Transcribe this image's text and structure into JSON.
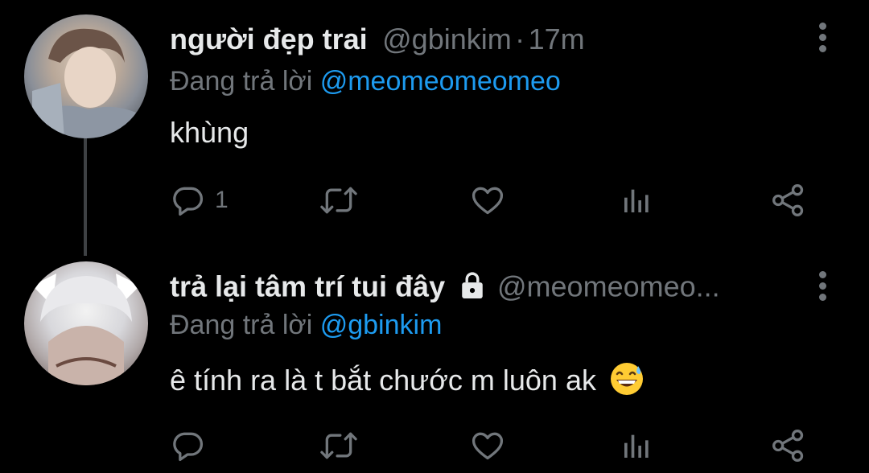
{
  "tweets": [
    {
      "name": "người đẹp trai",
      "handle": "@gbinkim",
      "separator": "·",
      "time": "17m",
      "reply_prefix": "Đang trả lời",
      "reply_to": "@meomeomeomeo",
      "text": "khùng",
      "reply_count": "1",
      "locked": false
    },
    {
      "name": "trả lại tâm trí tui đây",
      "handle": "@meomeomeo...",
      "reply_prefix": "Đang trả lời",
      "reply_to": "@gbinkim",
      "text": "ê tính ra là t bắt chước m luôn ak",
      "emoji": "grinning-face-with-sweat",
      "reply_count": "",
      "locked": true
    }
  ],
  "colors": {
    "background": "#000000",
    "text": "#e7e9ea",
    "muted": "#71767b",
    "link": "#1d9bf0",
    "thread_line": "#3e4144"
  },
  "icons": [
    "reply-icon",
    "retweet-icon",
    "like-icon",
    "views-icon",
    "share-icon",
    "more-icon",
    "lock-icon"
  ]
}
